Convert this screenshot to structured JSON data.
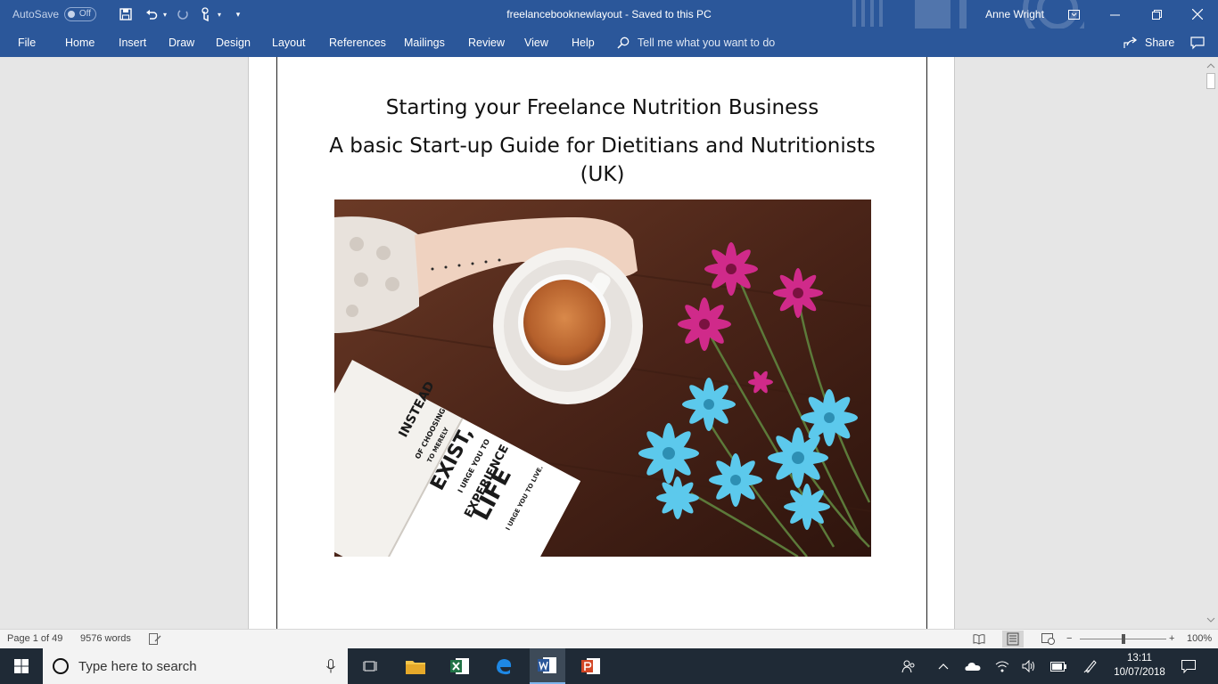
{
  "titlebar": {
    "autosave_label": "AutoSave",
    "autosave_state": "Off",
    "doc_title": "freelancebooknewlayout  -  Saved to this PC",
    "user_name": "Anne Wright"
  },
  "menu": {
    "items": [
      "File",
      "Home",
      "Insert",
      "Draw",
      "Design",
      "Layout",
      "References",
      "Mailings",
      "Review",
      "View",
      "Help"
    ],
    "tell_me": "Tell me what you want to do",
    "share": "Share"
  },
  "document": {
    "title": "Starting your Freelance Nutrition Business",
    "subtitle_line1": "A basic Start-up Guide for Dietitians and Nutritionists",
    "subtitle_line2": "(UK)",
    "book_text": [
      "INSTEAD",
      "OF CHOOSING",
      "TO MERELY",
      "EXIST,",
      "I URGE YOU TO",
      "EXPERIENCE",
      "LIFE",
      "I URGE YOU TO LIVE."
    ]
  },
  "status": {
    "page": "Page 1 of 49",
    "words": "9576 words",
    "zoom": "100%",
    "zoom_level": 1.0
  },
  "taskbar": {
    "search_placeholder": "Type here to search",
    "time": "13:11",
    "date": "10/07/2018"
  },
  "colors": {
    "word_blue": "#2b579a",
    "taskbar": "#1f2a36"
  }
}
